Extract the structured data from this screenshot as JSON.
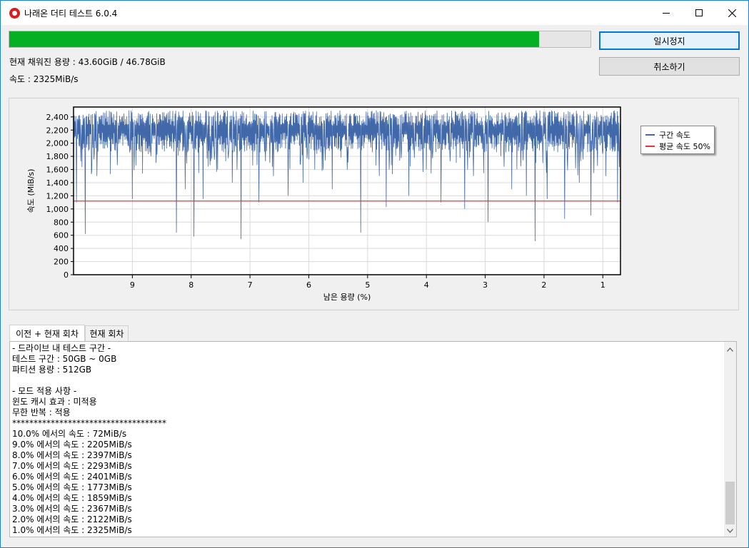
{
  "window": {
    "title": "나래온 더티 테스트 6.0.4",
    "controls": {
      "minimize": "minimize-icon",
      "maximize": "maximize-icon",
      "close": "close-icon"
    }
  },
  "progress": {
    "fraction": 0.9115,
    "color": "#06b025"
  },
  "buttons": {
    "pause": "일시정지",
    "cancel": "취소하기"
  },
  "status": {
    "filled_capacity": "현재 채워진 용량 : 43.60GiB / 46.78GiB",
    "speed": "속도 : 2325MiB/s"
  },
  "chart_data": {
    "type": "line",
    "xlabel": "남은 용량 (%)",
    "ylabel": "속도 (MiB/s)",
    "x_ticks": [
      "9",
      "8",
      "7",
      "6",
      "5",
      "4",
      "3",
      "2",
      "1"
    ],
    "y_ticks": [
      "0",
      "200",
      "400",
      "600",
      "800",
      "1,000",
      "1,200",
      "1,400",
      "1,600",
      "1,800",
      "2,000",
      "2,200",
      "2,400"
    ],
    "xlim": [
      10,
      0.7
    ],
    "ylim": [
      0,
      2550
    ],
    "x_reversed": true,
    "grid": true,
    "legend_position": "right",
    "series": [
      {
        "name": "구간 속도",
        "color": "#4169aa",
        "band_min": 1800,
        "band_max": 2500,
        "dips": [
          [
            9.95,
            1100
          ],
          [
            9.8,
            620
          ],
          [
            9.6,
            1500
          ],
          [
            9.0,
            1150
          ],
          [
            8.6,
            1700
          ],
          [
            8.25,
            640
          ],
          [
            8.1,
            1300
          ],
          [
            7.95,
            580
          ],
          [
            7.8,
            1150
          ],
          [
            7.55,
            1600
          ],
          [
            7.3,
            1400
          ],
          [
            7.15,
            540
          ],
          [
            6.85,
            1100
          ],
          [
            6.6,
            1500
          ],
          [
            6.35,
            1200
          ],
          [
            6.1,
            1400
          ],
          [
            5.9,
            1600
          ],
          [
            5.6,
            1300
          ],
          [
            5.12,
            640
          ],
          [
            4.8,
            1500
          ],
          [
            4.68,
            1030
          ],
          [
            4.3,
            1200
          ],
          [
            4.0,
            1600
          ],
          [
            3.75,
            1100
          ],
          [
            3.35,
            1000
          ],
          [
            3.2,
            1500
          ],
          [
            2.95,
            800
          ],
          [
            2.55,
            1300
          ],
          [
            2.3,
            1200
          ],
          [
            2.15,
            510
          ],
          [
            1.95,
            1150
          ],
          [
            1.65,
            850
          ],
          [
            1.4,
            1400
          ],
          [
            1.2,
            900
          ],
          [
            0.95,
            1500
          ],
          [
            0.75,
            1100
          ]
        ]
      },
      {
        "name": "평균 속도 50%",
        "color": "#ee3333",
        "value": 1120
      }
    ]
  },
  "tabs": [
    {
      "label": "이전 + 현재 회차",
      "active": true
    },
    {
      "label": "현재 회차",
      "active": false
    }
  ],
  "log": [
    "- 드라이브 내 테스트 구간 -",
    "테스트 구간 : 50GB ~ 0GB",
    "파티션 용량 : 512GB",
    "",
    "- 모드 적용 사항 -",
    "윈도 캐시 효과 : 미적용",
    "무한 반복 : 적용",
    "************************************",
    "10.0% 에서의 속도 : 72MiB/s",
    "9.0% 에서의 속도 : 2205MiB/s",
    "8.0% 에서의 속도 : 2397MiB/s",
    "7.0% 에서의 속도 : 2293MiB/s",
    "6.0% 에서의 속도 : 2401MiB/s",
    "5.0% 에서의 속도 : 1773MiB/s",
    "4.0% 에서의 속도 : 1859MiB/s",
    "3.0% 에서의 속도 : 2367MiB/s",
    "2.0% 에서의 속도 : 2122MiB/s",
    "1.0% 에서의 속도 : 2325MiB/s"
  ],
  "scroll": {
    "up": "scroll-up-arrow-icon",
    "down": "scroll-down-arrow-icon"
  }
}
